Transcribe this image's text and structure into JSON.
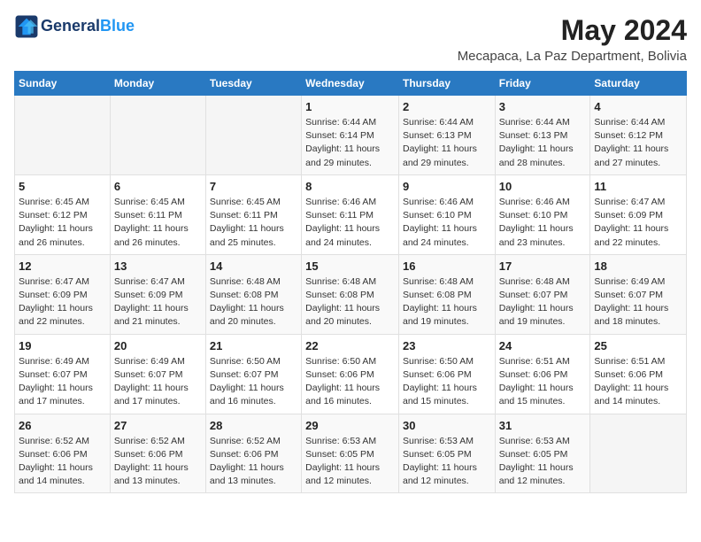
{
  "header": {
    "logo_line1": "General",
    "logo_line2": "Blue",
    "month_year": "May 2024",
    "location": "Mecapaca, La Paz Department, Bolivia"
  },
  "weekdays": [
    "Sunday",
    "Monday",
    "Tuesday",
    "Wednesday",
    "Thursday",
    "Friday",
    "Saturday"
  ],
  "weeks": [
    [
      {
        "day": "",
        "info": ""
      },
      {
        "day": "",
        "info": ""
      },
      {
        "day": "",
        "info": ""
      },
      {
        "day": "1",
        "info": "Sunrise: 6:44 AM\nSunset: 6:14 PM\nDaylight: 11 hours and 29 minutes."
      },
      {
        "day": "2",
        "info": "Sunrise: 6:44 AM\nSunset: 6:13 PM\nDaylight: 11 hours and 29 minutes."
      },
      {
        "day": "3",
        "info": "Sunrise: 6:44 AM\nSunset: 6:13 PM\nDaylight: 11 hours and 28 minutes."
      },
      {
        "day": "4",
        "info": "Sunrise: 6:44 AM\nSunset: 6:12 PM\nDaylight: 11 hours and 27 minutes."
      }
    ],
    [
      {
        "day": "5",
        "info": "Sunrise: 6:45 AM\nSunset: 6:12 PM\nDaylight: 11 hours and 26 minutes."
      },
      {
        "day": "6",
        "info": "Sunrise: 6:45 AM\nSunset: 6:11 PM\nDaylight: 11 hours and 26 minutes."
      },
      {
        "day": "7",
        "info": "Sunrise: 6:45 AM\nSunset: 6:11 PM\nDaylight: 11 hours and 25 minutes."
      },
      {
        "day": "8",
        "info": "Sunrise: 6:46 AM\nSunset: 6:11 PM\nDaylight: 11 hours and 24 minutes."
      },
      {
        "day": "9",
        "info": "Sunrise: 6:46 AM\nSunset: 6:10 PM\nDaylight: 11 hours and 24 minutes."
      },
      {
        "day": "10",
        "info": "Sunrise: 6:46 AM\nSunset: 6:10 PM\nDaylight: 11 hours and 23 minutes."
      },
      {
        "day": "11",
        "info": "Sunrise: 6:47 AM\nSunset: 6:09 PM\nDaylight: 11 hours and 22 minutes."
      }
    ],
    [
      {
        "day": "12",
        "info": "Sunrise: 6:47 AM\nSunset: 6:09 PM\nDaylight: 11 hours and 22 minutes."
      },
      {
        "day": "13",
        "info": "Sunrise: 6:47 AM\nSunset: 6:09 PM\nDaylight: 11 hours and 21 minutes."
      },
      {
        "day": "14",
        "info": "Sunrise: 6:48 AM\nSunset: 6:08 PM\nDaylight: 11 hours and 20 minutes."
      },
      {
        "day": "15",
        "info": "Sunrise: 6:48 AM\nSunset: 6:08 PM\nDaylight: 11 hours and 20 minutes."
      },
      {
        "day": "16",
        "info": "Sunrise: 6:48 AM\nSunset: 6:08 PM\nDaylight: 11 hours and 19 minutes."
      },
      {
        "day": "17",
        "info": "Sunrise: 6:48 AM\nSunset: 6:07 PM\nDaylight: 11 hours and 19 minutes."
      },
      {
        "day": "18",
        "info": "Sunrise: 6:49 AM\nSunset: 6:07 PM\nDaylight: 11 hours and 18 minutes."
      }
    ],
    [
      {
        "day": "19",
        "info": "Sunrise: 6:49 AM\nSunset: 6:07 PM\nDaylight: 11 hours and 17 minutes."
      },
      {
        "day": "20",
        "info": "Sunrise: 6:49 AM\nSunset: 6:07 PM\nDaylight: 11 hours and 17 minutes."
      },
      {
        "day": "21",
        "info": "Sunrise: 6:50 AM\nSunset: 6:07 PM\nDaylight: 11 hours and 16 minutes."
      },
      {
        "day": "22",
        "info": "Sunrise: 6:50 AM\nSunset: 6:06 PM\nDaylight: 11 hours and 16 minutes."
      },
      {
        "day": "23",
        "info": "Sunrise: 6:50 AM\nSunset: 6:06 PM\nDaylight: 11 hours and 15 minutes."
      },
      {
        "day": "24",
        "info": "Sunrise: 6:51 AM\nSunset: 6:06 PM\nDaylight: 11 hours and 15 minutes."
      },
      {
        "day": "25",
        "info": "Sunrise: 6:51 AM\nSunset: 6:06 PM\nDaylight: 11 hours and 14 minutes."
      }
    ],
    [
      {
        "day": "26",
        "info": "Sunrise: 6:52 AM\nSunset: 6:06 PM\nDaylight: 11 hours and 14 minutes."
      },
      {
        "day": "27",
        "info": "Sunrise: 6:52 AM\nSunset: 6:06 PM\nDaylight: 11 hours and 13 minutes."
      },
      {
        "day": "28",
        "info": "Sunrise: 6:52 AM\nSunset: 6:06 PM\nDaylight: 11 hours and 13 minutes."
      },
      {
        "day": "29",
        "info": "Sunrise: 6:53 AM\nSunset: 6:05 PM\nDaylight: 11 hours and 12 minutes."
      },
      {
        "day": "30",
        "info": "Sunrise: 6:53 AM\nSunset: 6:05 PM\nDaylight: 11 hours and 12 minutes."
      },
      {
        "day": "31",
        "info": "Sunrise: 6:53 AM\nSunset: 6:05 PM\nDaylight: 11 hours and 12 minutes."
      },
      {
        "day": "",
        "info": ""
      }
    ]
  ]
}
